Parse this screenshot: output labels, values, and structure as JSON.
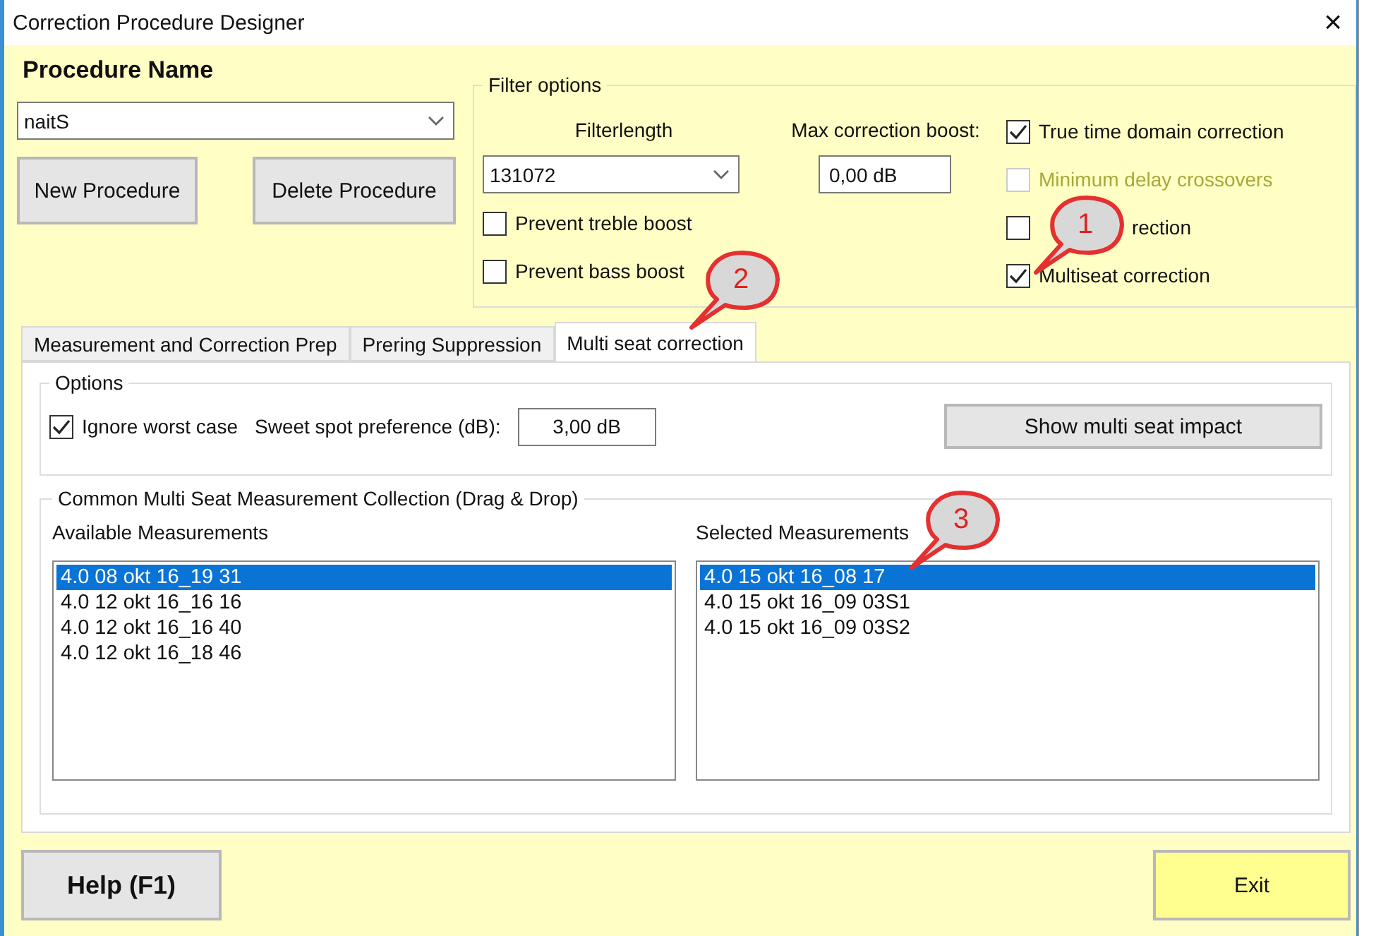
{
  "window": {
    "title": "Correction Procedure Designer",
    "close": "×"
  },
  "procedure": {
    "heading": "Procedure Name",
    "value": "naitS",
    "buttons": [
      "New Procedure",
      "Delete Procedure"
    ]
  },
  "filter_options": {
    "title": "Filter options",
    "filterlength_label": "Filterlength",
    "filterlength_value": "131072",
    "boost_label": "Max correction boost:",
    "boost_value": "0,00 dB",
    "left_checks": [
      {
        "label": "Prevent treble boost",
        "checked": false
      },
      {
        "label": "Prevent bass boost",
        "checked": false
      }
    ],
    "right_checks": [
      {
        "label": "True time domain correction",
        "checked": true,
        "disabled": false
      },
      {
        "label": "Minimum delay crossovers",
        "checked": false,
        "disabled": true
      },
      {
        "label": "rection",
        "covered": true,
        "checked": false,
        "disabled": false
      },
      {
        "label": "Multiseat correction",
        "checked": true,
        "disabled": false
      }
    ]
  },
  "tabs": [
    {
      "label": "Measurement and Correction Prep",
      "selected": false
    },
    {
      "label": "Prering Suppression",
      "selected": false
    },
    {
      "label": "Multi seat correction",
      "selected": true
    }
  ],
  "options": {
    "title": "Options",
    "ignore_worst": {
      "label": "Ignore worst case",
      "checked": true
    },
    "sweet_label": "Sweet spot preference (dB):",
    "sweet_value": "3,00 dB",
    "impact_button": "Show multi seat impact"
  },
  "collection": {
    "title": "Common Multi Seat Measurement Collection  (Drag & Drop)",
    "available": {
      "title": "Available Measurements",
      "items": [
        {
          "label": "4.0 08 okt 16_19 31",
          "selected": true
        },
        {
          "label": "4.0 12 okt 16_16 16",
          "selected": false
        },
        {
          "label": "4.0 12 okt 16_16 40",
          "selected": false
        },
        {
          "label": "4.0 12 okt 16_18 46",
          "selected": false
        }
      ]
    },
    "selected": {
      "title": "Selected Measurements",
      "items": [
        {
          "label": "4.0 15 okt 16_08 17",
          "selected": true
        },
        {
          "label": "4.0 15 okt 16_09 03S1",
          "selected": false
        },
        {
          "label": "4.0 15 okt 16_09 03S2",
          "selected": false
        }
      ]
    }
  },
  "footer": {
    "help": "Help (F1)",
    "exit": "Exit"
  },
  "callouts": [
    "1",
    "2",
    "3"
  ]
}
